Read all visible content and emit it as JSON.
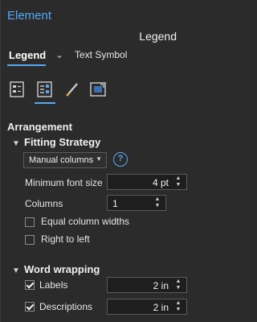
{
  "panel": {
    "title": "Element",
    "subject": "Legend"
  },
  "tabs": {
    "active": "Legend",
    "other": "Text Symbol"
  },
  "icons": [
    "legend-items-icon",
    "arrangement-icon",
    "display-icon",
    "placement-icon"
  ],
  "arrangement": {
    "heading": "Arrangement",
    "fitting": {
      "heading": "Fitting Strategy",
      "strategy_value": "Manual columns",
      "help": "?",
      "min_font_label": "Minimum font size",
      "min_font_value": "4 pt",
      "columns_label": "Columns",
      "columns_value": "1",
      "equal_widths_label": "Equal column widths",
      "equal_widths_checked": false,
      "rtl_label": "Right to left",
      "rtl_checked": false
    },
    "wrapping": {
      "heading": "Word wrapping",
      "labels_label": "Labels",
      "labels_checked": true,
      "labels_value": "2 in",
      "desc_label": "Descriptions",
      "desc_checked": true,
      "desc_value": "2 in"
    }
  },
  "colors": {
    "accent": "#56a8f5",
    "background": "#2b2b2b"
  }
}
